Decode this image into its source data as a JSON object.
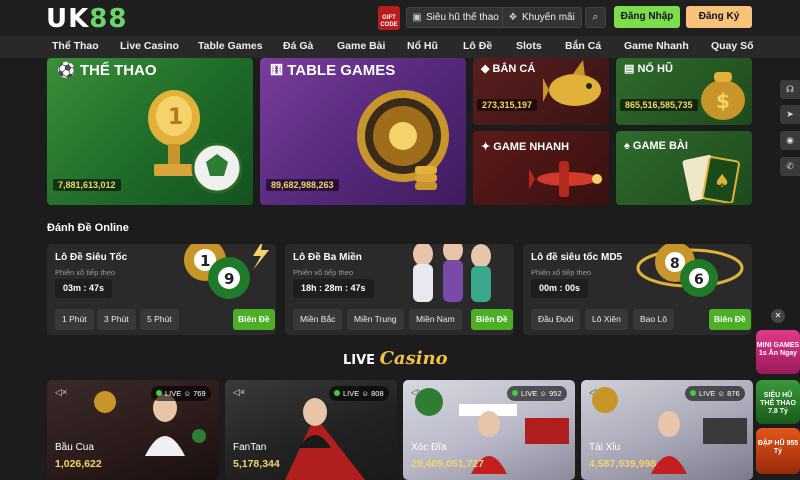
{
  "header": {
    "logo_main": "UK",
    "logo_accent": "88",
    "gift_label": "GIFT CODE",
    "super_hu_label": "Siêu hũ thế thao",
    "promo_label": "Khuyến mãi",
    "login_label": "Đăng Nhập",
    "register_label": "Đăng Ký"
  },
  "nav": {
    "items": [
      "Thể Thao",
      "Live Casino",
      "Table Games",
      "Đá Gà",
      "Game Bài",
      "Nổ Hũ",
      "Lô Đề",
      "Slots",
      "Bắn Cá",
      "Game Nhanh",
      "Quay Số"
    ]
  },
  "tiles": {
    "the_thao": {
      "title": "THỂ THAO",
      "count": "7,881,613,012"
    },
    "table_games": {
      "title": "TABLE GAMES",
      "count": "89,682,988,263"
    },
    "ban_ca": {
      "title": "BẮN CÁ",
      "count": "273,315,197"
    },
    "no_hu": {
      "title": "NỔ HŨ",
      "count": "865,516,585,735"
    },
    "game_nhanh": {
      "title": "GAME NHANH"
    },
    "game_bai": {
      "title": "GAME BÀI"
    }
  },
  "lottery": {
    "section_title": "Đánh Đề Online",
    "cards": [
      {
        "name": "Lô Đề Siêu Tốc",
        "sub": "Phiên xổ tiếp theo",
        "timer": "03m : 47s",
        "options": [
          "1 Phút",
          "3 Phút",
          "5 Phút"
        ],
        "go": "Biên Đề"
      },
      {
        "name": "Lô Đề Ba Miền",
        "sub": "Phiên xổ tiếp theo",
        "timer": "18h : 28m : 47s",
        "options": [
          "Miền Bắc",
          "Miền Trung",
          "Miền Nam"
        ],
        "go": "Biên Đề"
      },
      {
        "name": "Lô đề siêu tốc MD5",
        "sub": "Phiên xổ tiếp theo",
        "timer": "00m : 00s",
        "options": [
          "Đầu Đuôi",
          "Lô Xiên",
          "Bao Lô"
        ],
        "go": "Biên Đề"
      }
    ]
  },
  "live": {
    "title_prefix": "LIVE",
    "title_script": "Casino",
    "live_tag": "LIVE",
    "cards": [
      {
        "name": "Bầu Cua",
        "amount": "1,026,622",
        "viewers": "769"
      },
      {
        "name": "FanTan",
        "amount": "5,178,344",
        "viewers": "808"
      },
      {
        "name": "Xóc Đĩa",
        "amount": "29,409,051,727",
        "viewers": "952"
      },
      {
        "name": "Tài Xỉu",
        "amount": "4,587,939,998",
        "viewers": "876"
      }
    ]
  },
  "promos": {
    "mini_games": "MINI GAMES 1s Ăn Ngay",
    "sieu_hu": "SIÊU HŨ THỂ THAO 7.8 Tỷ",
    "dap_hu": "ĐẬP HŨ 955 Tỷ"
  },
  "colors": {
    "accent_green": "#7dde4b",
    "accent_gold": "#f7c37a",
    "amount_gold": "#f5d36a",
    "bg": "#1c1c1c"
  }
}
